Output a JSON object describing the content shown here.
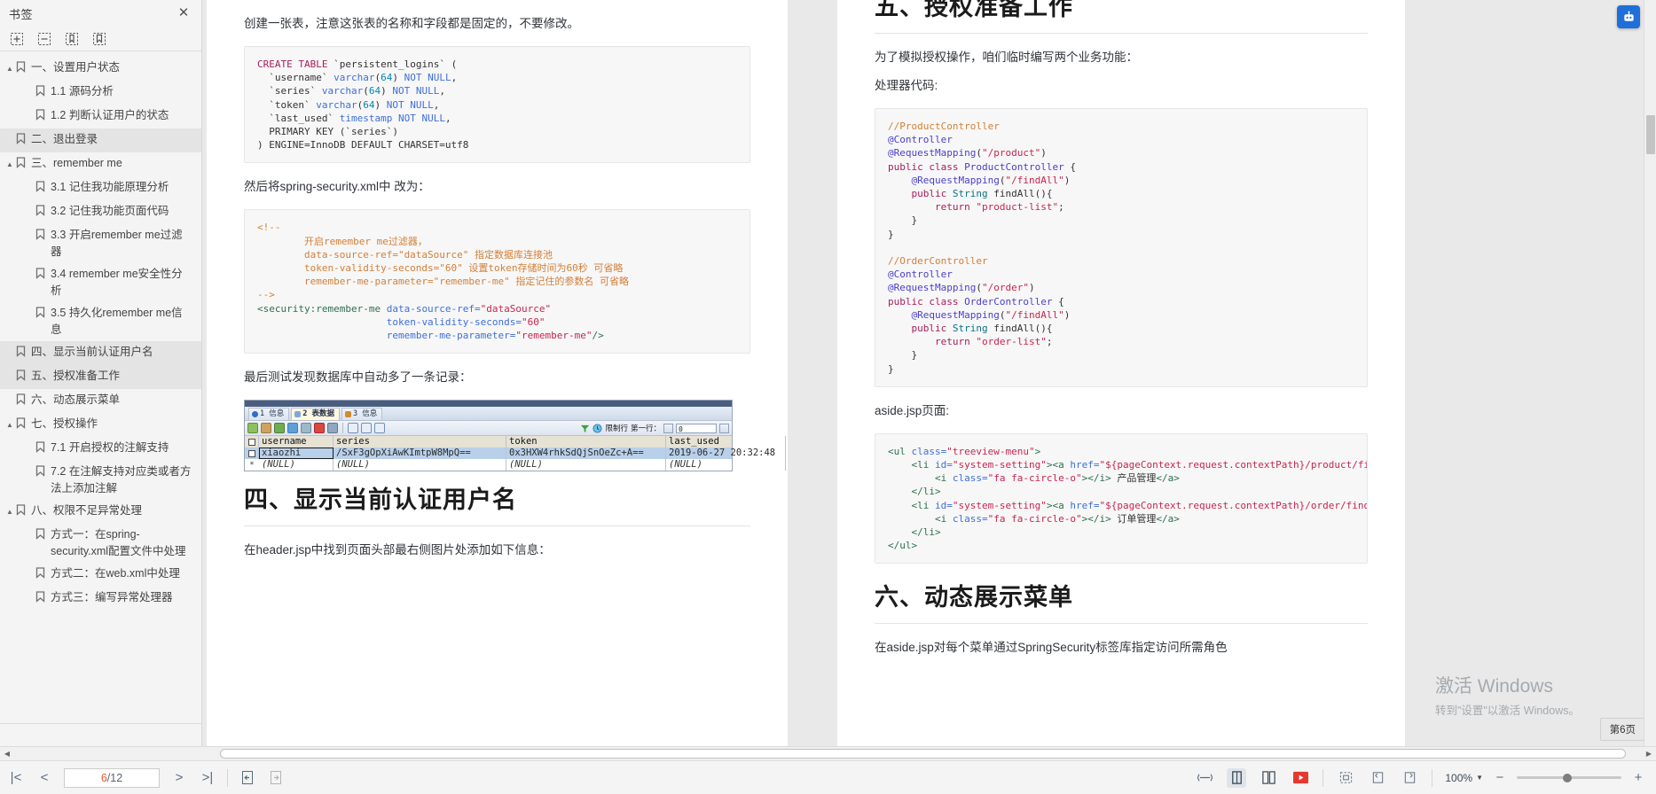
{
  "sidebar": {
    "title": "书签",
    "close_label": "✕",
    "tools": [
      {
        "name": "expand-all-icon",
        "label": "展开全部"
      },
      {
        "name": "collapse-all-icon",
        "label": "折叠全部"
      },
      {
        "name": "add-bookmark-icon",
        "label": "添加书签"
      },
      {
        "name": "remove-bookmark-icon",
        "label": "删除书签"
      }
    ],
    "items": [
      {
        "label": "一、设置用户状态",
        "level": 0,
        "arrow": "▲",
        "selected": false
      },
      {
        "label": "1.1 源码分析",
        "level": 1,
        "arrow": "",
        "selected": false
      },
      {
        "label": "1.2 判断认证用户的状态",
        "level": 1,
        "arrow": "",
        "selected": false
      },
      {
        "label": "二、退出登录",
        "level": 0,
        "arrow": "",
        "selected": true
      },
      {
        "label": "三、remember me",
        "level": 0,
        "arrow": "▲",
        "selected": false
      },
      {
        "label": "3.1 记住我功能原理分析",
        "level": 1,
        "arrow": "",
        "selected": false
      },
      {
        "label": "3.2 记住我功能页面代码",
        "level": 1,
        "arrow": "",
        "selected": false
      },
      {
        "label": "3.3 开启remember me过滤器",
        "level": 1,
        "arrow": "",
        "selected": false
      },
      {
        "label": "3.4 remember me安全性分析",
        "level": 1,
        "arrow": "",
        "selected": false
      },
      {
        "label": "3.5 持久化remember me信息",
        "level": 1,
        "arrow": "",
        "selected": false
      },
      {
        "label": "四、显示当前认证用户名",
        "level": 0,
        "arrow": "",
        "selected": true
      },
      {
        "label": "五、授权准备工作",
        "level": 0,
        "arrow": "",
        "selected": true
      },
      {
        "label": "六、动态展示菜单",
        "level": 0,
        "arrow": "",
        "selected": false
      },
      {
        "label": "七、授权操作",
        "level": 0,
        "arrow": "▲",
        "selected": false
      },
      {
        "label": "7.1 开启授权的注解支持",
        "level": 1,
        "arrow": "",
        "selected": false
      },
      {
        "label": "7.2 在注解支持对应类或者方法上添加注解",
        "level": 1,
        "arrow": "",
        "selected": false
      },
      {
        "label": "八、权限不足异常处理",
        "level": 0,
        "arrow": "▲",
        "selected": false
      },
      {
        "label": "方式一：在spring-security.xml配置文件中处理",
        "level": 1,
        "arrow": "",
        "selected": false
      },
      {
        "label": "方式二：在web.xml中处理",
        "level": 1,
        "arrow": "",
        "selected": false
      },
      {
        "label": "方式三：编写异常处理器",
        "level": 1,
        "arrow": "",
        "selected": false
      }
    ]
  },
  "left_page": {
    "para1": "创建一张表，注意这张表的名称和字段都是固定的，不要修改。",
    "code1": "CREATE TABLE `persistent_logins` (\n  `username` varchar(64) NOT NULL,\n  `series` varchar(64) NOT NULL,\n  `token` varchar(64) NOT NULL,\n  `last_used` timestamp NOT NULL,\n  PRIMARY KEY (`series`)\n) ENGINE=InnoDB DEFAULT CHARSET=utf8",
    "para2": "然后将spring-security.xml中 改为：",
    "code2": "<!--\n        开启remember me过滤器，\n        data-source-ref=\"dataSource\" 指定数据库连接池\n        token-validity-seconds=\"60\" 设置token存储时间为60秒 可省略\n        remember-me-parameter=\"remember-me\" 指定记住的参数名 可省略\n-->\n<security:remember-me data-source-ref=\"dataSource\"\n                      token-validity-seconds=\"60\"\n                      remember-me-parameter=\"remember-me\"/>",
    "para3": "最后测试发现数据库中自动多了一条记录：",
    "heading": "四、显示当前认证用户名",
    "para4": "在header.jsp中找到页面头部最右侧图片处添加如下信息："
  },
  "db_shot": {
    "tabs": [
      {
        "label": "1 信息",
        "active": false,
        "dot": "b"
      },
      {
        "label": "2 表数据",
        "active": true,
        "dot": "g"
      },
      {
        "label": "3 信息",
        "active": false,
        "dot": "o"
      }
    ],
    "limit_label": "限制行",
    "row_label": "第一行：",
    "row_value": "0",
    "columns": [
      "username",
      "series",
      "token",
      "last_used"
    ],
    "rows": [
      [
        "xiaozhi",
        "/SxF3gOpXiAwKImtpW8MpQ==",
        "0x3HXW4rhkSdQjSnOeZc+A==",
        "2019-06-27 20:32:48"
      ],
      [
        "(NULL)",
        "(NULL)",
        "(NULL)",
        "(NULL)"
      ]
    ]
  },
  "right_page": {
    "heading1": "五、授权准备工作",
    "para1": "为了模拟授权操作，咱们临时编写两个业务功能：",
    "para2": "处理器代码:",
    "code1": "//ProductController\n@Controller\n@RequestMapping(\"/product\")\npublic class ProductController {\n    @RequestMapping(\"/findAll\")\n    public String findAll(){\n        return \"product-list\";\n    }\n}\n\n//OrderController\n@Controller\n@RequestMapping(\"/order\")\npublic class OrderController {\n    @RequestMapping(\"/findAll\")\n    public String findAll(){\n        return \"order-list\";\n    }\n}",
    "para3": "aside.jsp页面:",
    "code2": "<ul class=\"treeview-menu\">\n    <li id=\"system-setting\"><a href=\"${pageContext.request.contextPath}/product/findAll\">\n        <i class=\"fa fa-circle-o\"></i> 产品管理</a>\n    </li>\n    <li id=\"system-setting\"><a href=\"${pageContext.request.contextPath}/order/findAll\">\n        <i class=\"fa fa-circle-o\"></i> 订单管理</a>\n    </li>\n</ul>",
    "heading2": "六、动态展示菜单",
    "para4": "在aside.jsp对每个菜单通过SpringSecurity标签库指定访问所需角色"
  },
  "watermark": {
    "line1": "激活 Windows",
    "line2": "转到\"设置\"以激活 Windows。"
  },
  "page_pill": "第6页",
  "bottombar": {
    "first_label": "|<",
    "prev_label": "<",
    "page_current": "6",
    "page_sep": "/",
    "page_total": "12",
    "next_label": ">",
    "last_label": ">|",
    "back_label": "←",
    "forward_label": "→",
    "zoom_value": "100%",
    "zoom_minus": "−",
    "zoom_plus": "+",
    "view_icons": [
      {
        "name": "fit-width-icon",
        "active": false
      },
      {
        "name": "single-page-icon",
        "active": true
      },
      {
        "name": "two-page-icon",
        "active": false
      },
      {
        "name": "presentation-icon",
        "active": false
      },
      {
        "name": "snapshot-icon",
        "active": false
      },
      {
        "name": "rotate-left-icon",
        "active": false
      },
      {
        "name": "rotate-right-icon",
        "active": false
      },
      {
        "name": "cursor-icon",
        "active": false
      }
    ]
  },
  "colors": {
    "accent": "#1e6fd9",
    "sidebar_bg": "#f4f4f4",
    "selected_bg": "#e4e4e4",
    "page_bg": "#e9e9e9",
    "code_bg": "#f7f7f7",
    "page_number_hl": "#e35c2a"
  }
}
